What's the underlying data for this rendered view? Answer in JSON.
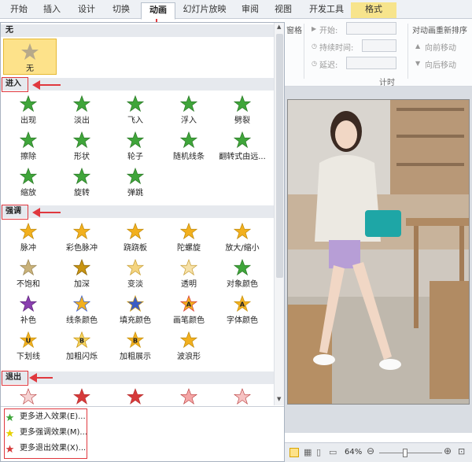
{
  "tabs": [
    "开始",
    "插入",
    "设计",
    "切换",
    "动画",
    "幻灯片放映",
    "审阅",
    "视图",
    "开发工具",
    "格式"
  ],
  "active_tab": "动画",
  "ribbon": {
    "group_partial": "窗格",
    "start_label": "开始:",
    "duration_label": "持续时间:",
    "delay_label": "延迟:",
    "reorder_label": "对动画重新排序",
    "move_earlier": "向前移动",
    "move_later": "向后移动",
    "timing_group": "计时"
  },
  "gallery": {
    "none_section": "无",
    "none_item": "无",
    "enter_section": "进入",
    "enter_items": [
      "出现",
      "淡出",
      "飞入",
      "浮入",
      "劈裂",
      "擦除",
      "形状",
      "轮子",
      "随机线条",
      "翻转式由远...",
      "缩放",
      "旋转",
      "弹跳"
    ],
    "emphasis_section": "强调",
    "emphasis_items": [
      "脉冲",
      "彩色脉冲",
      "跷跷板",
      "陀螺旋",
      "放大/缩小",
      "不饱和",
      "加深",
      "变淡",
      "透明",
      "对象颜色",
      "补色",
      "线条颜色",
      "填充颜色",
      "画笔颜色",
      "字体颜色",
      "下划线",
      "加粗闪烁",
      "加粗展示",
      "波浪形"
    ],
    "exit_section": "退出",
    "more_enter": "更多进入效果(E)...",
    "more_emphasis": "更多强调效果(M)...",
    "more_exit": "更多退出效果(X)..."
  },
  "status": {
    "zoom": "64%"
  },
  "colors": {
    "enter_green": "#3fa53a",
    "emphasis_gold": "#f2b01e",
    "exit_red": "#d63a3a",
    "annotation_red": "#e0383e",
    "selected_tile": "#fde28a"
  }
}
